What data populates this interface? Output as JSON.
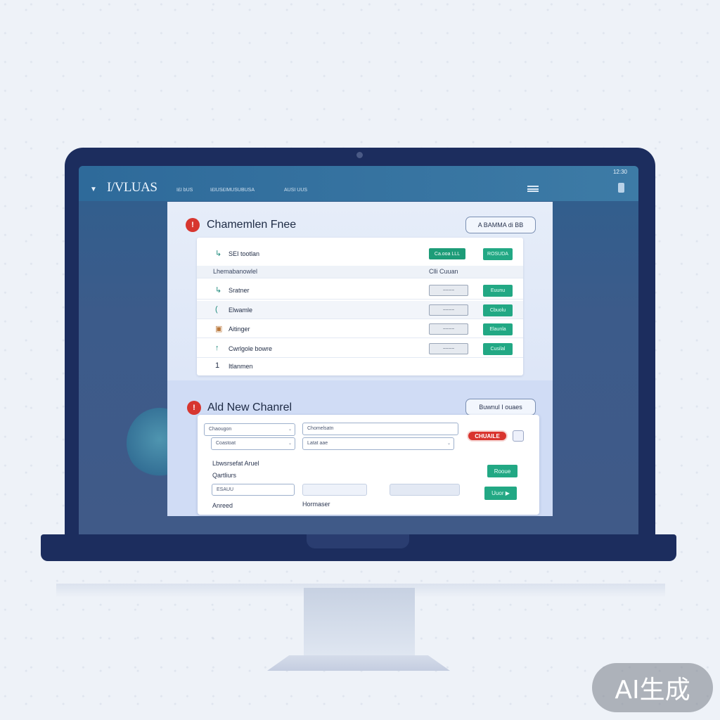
{
  "app": {
    "logo": "I/VLUAS",
    "time": "12:30",
    "nav_items": [
      "I£I bUS",
      "I£IUS£IMUSUBUSA",
      "AUSI UUS"
    ]
  },
  "channels": {
    "title": "Chamemlen Fnee",
    "top_button": "A  ВAMMA  di  ВB",
    "header": {
      "label": "Lhemabanowlel",
      "column": "Clli Cuuan"
    },
    "rows": [
      {
        "icon": "↳",
        "label": "SEI tootlan",
        "status": "Ca.ooa  LLL",
        "status_on": true,
        "action": "ROSUDA"
      },
      {
        "icon": "↳",
        "label": "Sratner",
        "status": "~~~~",
        "status_on": false,
        "action": "Euunu"
      },
      {
        "icon": "(",
        "label": "Elwamle",
        "status": "~~~~",
        "status_on": false,
        "action": "Cbuolu"
      },
      {
        "icon": "▣",
        "label": "Aitinger",
        "status": "~~~~",
        "status_on": false,
        "action": "Elaunla"
      },
      {
        "icon": "↑",
        "label": "Cwrlgole bowre",
        "status": "~~~~",
        "status_on": false,
        "action": "Cusilal"
      },
      {
        "icon": "1",
        "label": "Itlanmen",
        "status": "",
        "status_on": false,
        "action": ""
      }
    ]
  },
  "add_channel": {
    "title": "Ald New Chanrel",
    "top_button": "Buwnul I ouaes",
    "fields": {
      "field1": "Chaougon",
      "field1b": "Coastoat",
      "field2": "Chomelsatn",
      "field2b": "Latat aae",
      "small": "ESAUU"
    },
    "badge": "CHUAILE",
    "labels": {
      "desc": "Lbwsrsefat Aruel",
      "sub": "Qartliurs",
      "amount": "Anreed",
      "bottom": "Hormaser"
    },
    "buttons": {
      "save": "Rooue",
      "next": "Uuor ▶"
    }
  },
  "watermark": "AI生成"
}
